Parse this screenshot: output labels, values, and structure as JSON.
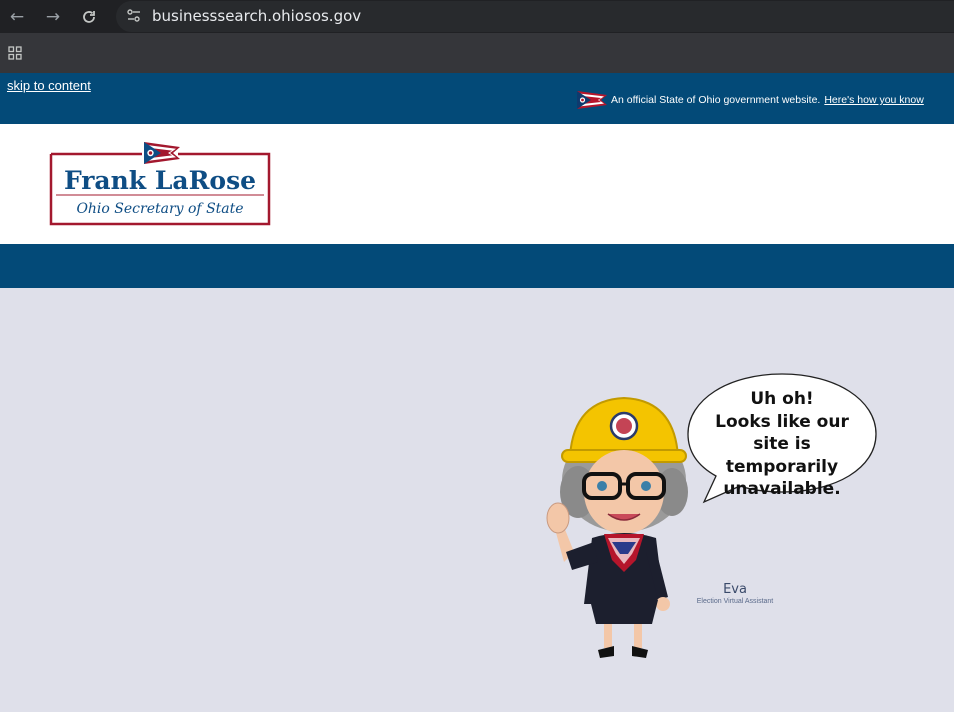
{
  "browser": {
    "url": "businesssearch.ohiosos.gov",
    "icons": [
      "back-arrow-icon",
      "forward-arrow-icon",
      "reload-icon",
      "site-info-icon",
      "apps-grid-icon"
    ]
  },
  "gov_banner": {
    "skip_link": "skip to content",
    "official_text": "An official State of Ohio government website.",
    "how_link": "Here's how you know"
  },
  "logo": {
    "name": "Frank LaRose",
    "subtitle": "Ohio Secretary of State"
  },
  "eva": {
    "bubble_lines": [
      "Uh oh!",
      "Looks like our",
      "site is temporarily",
      "unavailable."
    ],
    "name": "Eva",
    "subtitle": "Election Virtual Assistant"
  },
  "colors": {
    "banner_blue": "#034a78",
    "page_bg": "#dfe0ea",
    "logo_blue": "#0e4d84",
    "logo_red": "#a3182e",
    "helmet_yellow": "#f4c400"
  }
}
